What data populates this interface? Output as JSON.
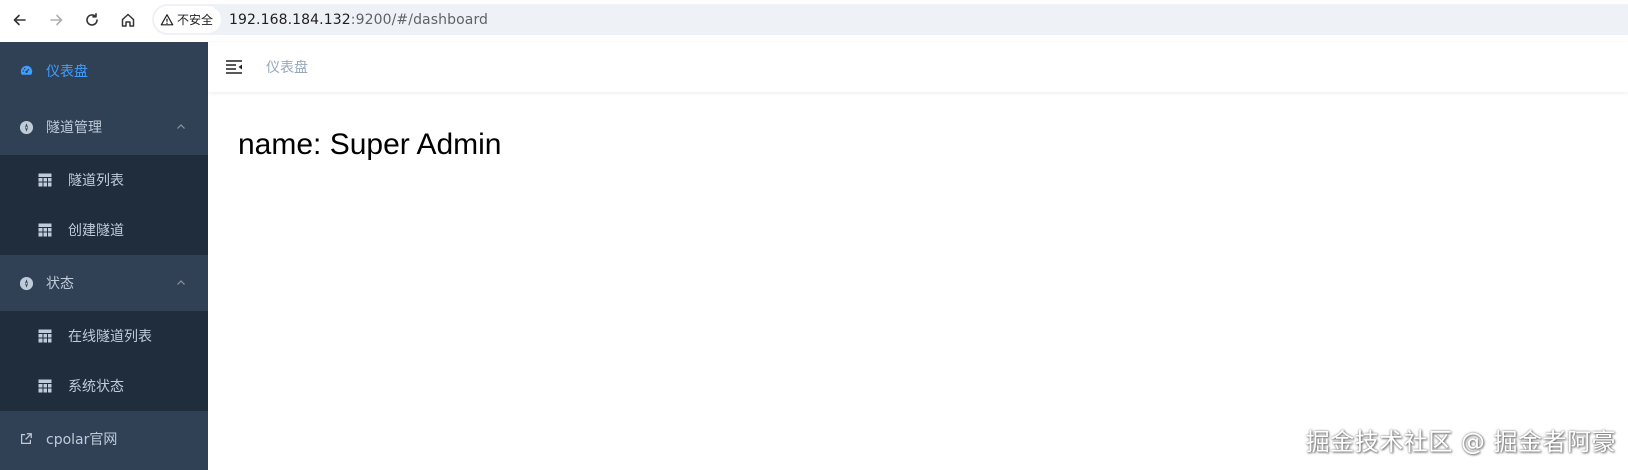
{
  "browser": {
    "security_label": "不安全",
    "url_host": "192.168.184.132",
    "url_rest": ":9200/#/dashboard",
    "icons": {
      "back": "back-arrow-icon",
      "forward": "forward-arrow-icon",
      "reload": "reload-icon",
      "home": "home-icon",
      "security": "warning-triangle-icon"
    }
  },
  "colors": {
    "sidebar_bg": "#304156",
    "submenu_bg": "#1f2d3d",
    "active": "#409eff",
    "menu_text": "#bfcbd9"
  },
  "sidebar": {
    "dashboard": "仪表盘",
    "group_tunnel": {
      "label": "隧道管理",
      "items": [
        "隧道列表",
        "创建隧道"
      ]
    },
    "group_status": {
      "label": "状态",
      "items": [
        "在线隧道列表",
        "系统状态"
      ]
    },
    "external": "cpolar官网"
  },
  "navbar": {
    "breadcrumb": "仪表盘"
  },
  "main": {
    "dashboard_text": "name: Super Admin"
  },
  "watermark": "掘金技术社区 @ 掘金者阿豪"
}
